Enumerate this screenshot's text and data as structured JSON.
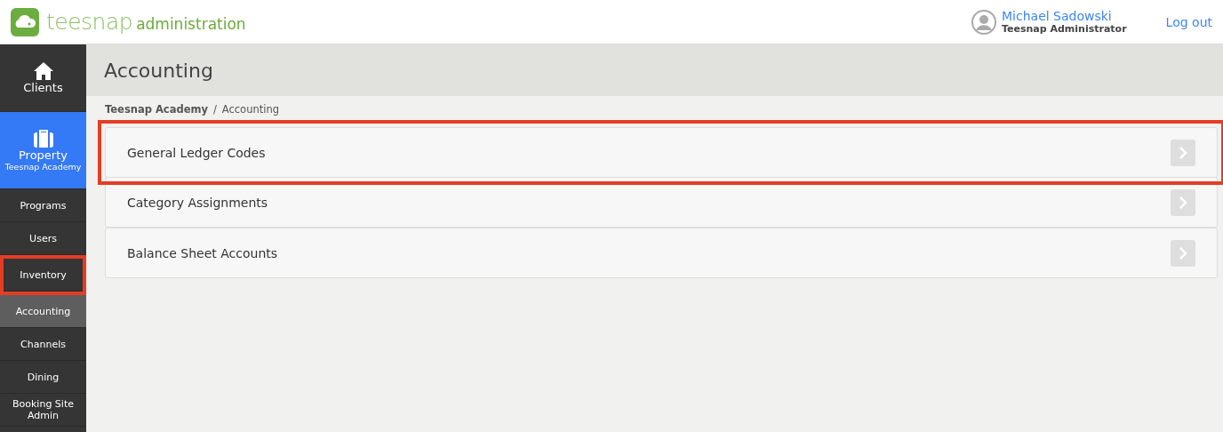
{
  "header": {
    "logo_word": "teesnap",
    "logo_suffix": "administration",
    "user_name": "Michael Sadowski",
    "user_role": "Teesnap Administrator",
    "logout": "Log out"
  },
  "sidebar": {
    "items": [
      {
        "kind": "icon",
        "label": "Clients",
        "selected": false,
        "highlighted": false
      },
      {
        "kind": "property",
        "label": "Property",
        "sublabel": "Teesnap Academy",
        "selected": true,
        "highlighted": false
      },
      {
        "kind": "sub",
        "label": "Programs",
        "selected": false,
        "highlighted": false
      },
      {
        "kind": "sub",
        "label": "Users",
        "selected": false,
        "highlighted": false
      },
      {
        "kind": "sub",
        "label": "Inventory",
        "selected": false,
        "highlighted": true
      },
      {
        "kind": "sub",
        "label": "Accounting",
        "selected": true,
        "highlighted": false
      },
      {
        "kind": "sub",
        "label": "Channels",
        "selected": false,
        "highlighted": false
      },
      {
        "kind": "sub",
        "label": "Dining",
        "selected": false,
        "highlighted": false
      },
      {
        "kind": "sub",
        "label": "Booking Site Admin",
        "selected": false,
        "highlighted": false
      }
    ]
  },
  "page": {
    "title": "Accounting",
    "breadcrumb": [
      "Teesnap Academy",
      "/",
      "Accounting"
    ],
    "items": [
      {
        "label": "General Ledger Codes",
        "highlighted": true
      },
      {
        "label": "Category Assignments",
        "highlighted": false
      },
      {
        "label": "Balance Sheet Accounts",
        "highlighted": false
      }
    ]
  }
}
